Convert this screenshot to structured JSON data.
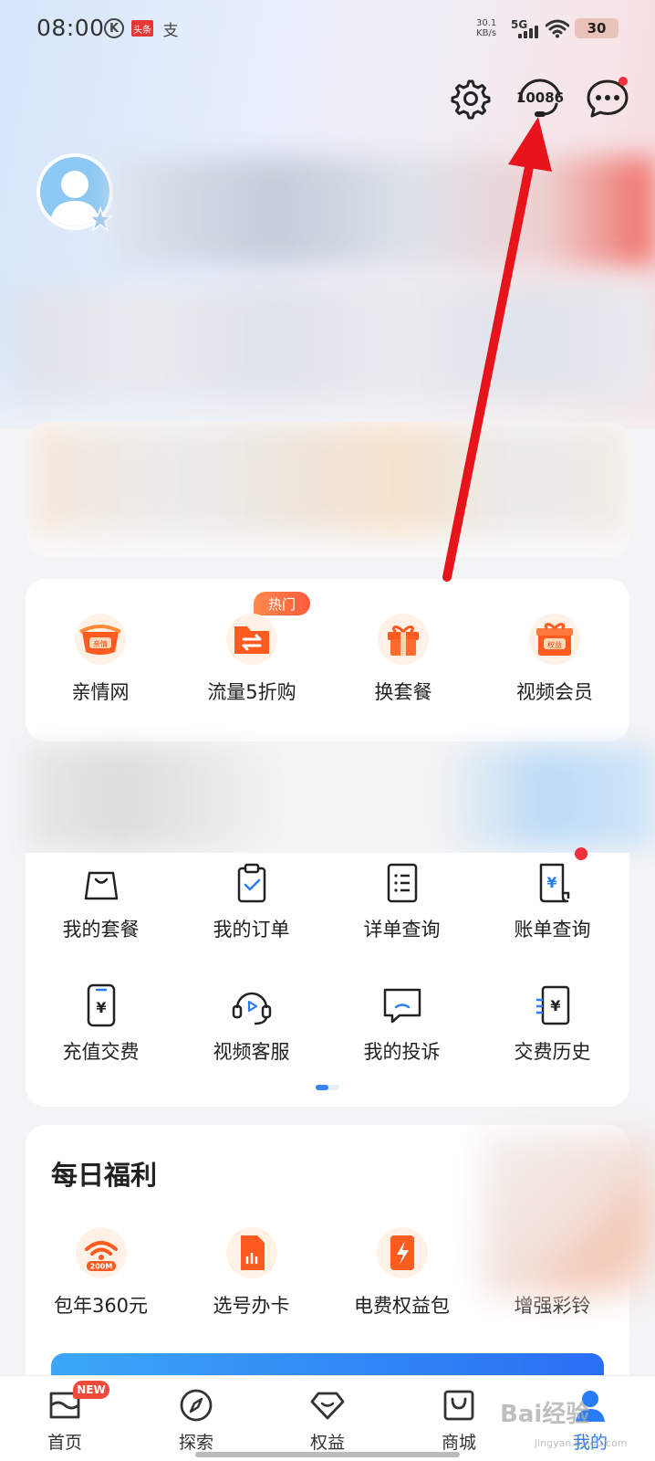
{
  "status_bar": {
    "time": "08:00",
    "net_speed_value": "30.1",
    "net_speed_unit": "KB/s",
    "signal": "5G",
    "battery": "30",
    "notif_icons": [
      "K",
      "头条",
      "支"
    ]
  },
  "header": {
    "customer_service_number": "10086"
  },
  "quick_services": {
    "hot_badge": "热门",
    "items": [
      {
        "label": "亲情网",
        "icon": "family-net-icon",
        "tag": "亲情"
      },
      {
        "label": "流量5折购",
        "icon": "data-folder-icon"
      },
      {
        "label": "换套餐",
        "icon": "gift-box-icon"
      },
      {
        "label": "视频会员",
        "icon": "benefit-gift-icon",
        "tag": "权益"
      }
    ]
  },
  "services": {
    "items": [
      {
        "label": "我的套餐",
        "icon": "shopping-bag-icon"
      },
      {
        "label": "我的订单",
        "icon": "clipboard-check-icon"
      },
      {
        "label": "详单查询",
        "icon": "document-list-icon"
      },
      {
        "label": "账单查询",
        "icon": "bill-yuan-icon"
      },
      {
        "label": "充值交费",
        "icon": "phone-yuan-icon"
      },
      {
        "label": "视频客服",
        "icon": "headset-play-icon"
      },
      {
        "label": "我的投诉",
        "icon": "chat-complaint-icon"
      },
      {
        "label": "交费历史",
        "icon": "payment-history-icon"
      }
    ]
  },
  "welfare": {
    "title": "每日福利",
    "items": [
      {
        "label": "包年360元",
        "icon": "wifi-200m-icon",
        "tag": "200M"
      },
      {
        "label": "选号办卡",
        "icon": "sim-card-icon"
      },
      {
        "label": "电费权益包",
        "icon": "electricity-icon"
      },
      {
        "label": "增强彩铃",
        "icon": "ringtone-icon"
      }
    ]
  },
  "bottom_nav": {
    "new_badge": "NEW",
    "items": [
      {
        "label": "首页",
        "icon": "home-icon"
      },
      {
        "label": "探索",
        "icon": "compass-icon"
      },
      {
        "label": "权益",
        "icon": "diamond-icon"
      },
      {
        "label": "商城",
        "icon": "store-bag-icon"
      },
      {
        "label": "我的",
        "icon": "profile-icon"
      }
    ]
  },
  "watermark": {
    "text": "Bai经验",
    "sub": "jingyan.baidu.com"
  },
  "colors": {
    "accent_blue": "#2a7cf6",
    "arrow_red": "#e8141c",
    "icon_orange": "#ff5a1f"
  }
}
